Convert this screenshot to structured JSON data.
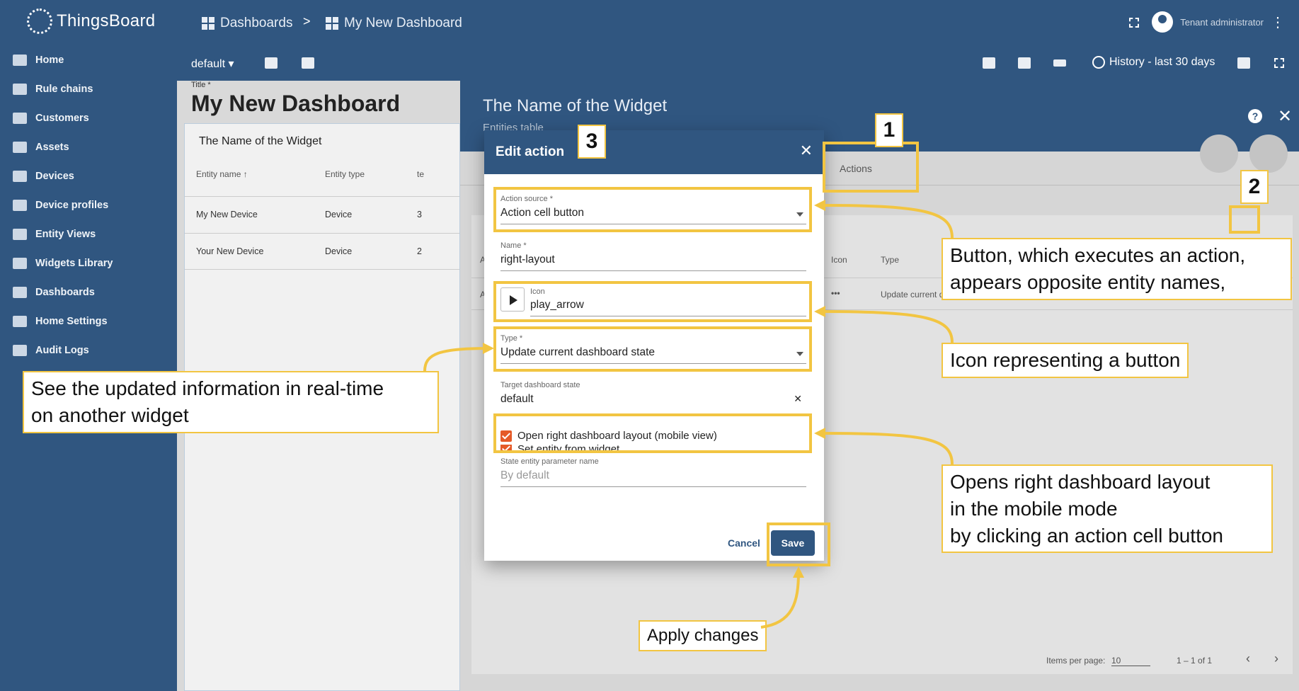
{
  "app": {
    "name": "ThingsBoard"
  },
  "breadcrumb": {
    "root": "Dashboards",
    "separator": ">",
    "current": "My New Dashboard"
  },
  "user": {
    "role": "Tenant administrator"
  },
  "sidebar": {
    "items": [
      {
        "label": "Home",
        "icon": "home-icon"
      },
      {
        "label": "Rule chains",
        "icon": "rule-chains-icon"
      },
      {
        "label": "Customers",
        "icon": "customers-icon"
      },
      {
        "label": "Assets",
        "icon": "assets-icon"
      },
      {
        "label": "Devices",
        "icon": "devices-icon"
      },
      {
        "label": "Device profiles",
        "icon": "device-profiles-icon"
      },
      {
        "label": "Entity Views",
        "icon": "entity-views-icon"
      },
      {
        "label": "Widgets Library",
        "icon": "widgets-icon"
      },
      {
        "label": "Dashboards",
        "icon": "dashboards-icon"
      },
      {
        "label": "Home Settings",
        "icon": "settings-icon"
      },
      {
        "label": "Audit Logs",
        "icon": "audit-logs-icon"
      }
    ]
  },
  "toolbar": {
    "state": "default",
    "history": "History - last 30 days"
  },
  "dashboard": {
    "title_label": "Title *",
    "title": "My New Dashboard",
    "widget": {
      "title": "The Name of the Widget",
      "columns": [
        "Entity name",
        "Entity type",
        "te"
      ],
      "rows": [
        {
          "name": "My New Device",
          "type": "Device",
          "extra": "3"
        },
        {
          "name": "Your New Device",
          "type": "Device",
          "extra": "2"
        }
      ]
    }
  },
  "editor": {
    "title": "The Name of the Widget",
    "subtitle": "Entities table",
    "tab_actions": "Actions",
    "columns": {
      "icon": "Icon",
      "type": "Type",
      "a": "A"
    },
    "row": {
      "icon": "•••",
      "type": "Update current dashboard state",
      "a": "A"
    },
    "pager": {
      "label": "Items per page:",
      "value": "10",
      "range": "1 – 1 of 1"
    }
  },
  "dialog": {
    "title": "Edit action",
    "action_source": {
      "label": "Action source *",
      "value": "Action cell button"
    },
    "name": {
      "label": "Name *",
      "value": "right-layout"
    },
    "icon": {
      "label": "Icon",
      "value": "play_arrow"
    },
    "type": {
      "label": "Type *",
      "value": "Update current dashboard state"
    },
    "target_state": {
      "label": "Target dashboard state",
      "value": "default"
    },
    "open_right_layout": "Open right dashboard layout (mobile view)",
    "set_entity": "Set entity from widget",
    "state_param": {
      "label": "State entity parameter name",
      "placeholder": "By default"
    },
    "cancel": "Cancel",
    "save": "Save"
  },
  "annotations": {
    "num1": "1",
    "num2": "2",
    "num3": "3",
    "button_desc_1": "Button, which executes an action,",
    "button_desc_2": "appears opposite entity names,",
    "icon_desc": "Icon representing a button",
    "realtime_1": "See the updated information in real-time",
    "realtime_2": "on another widget",
    "opens_1": "Opens right dashboard layout",
    "opens_2": "in the mobile mode",
    "opens_3": "by clicking an action cell button",
    "apply": "Apply changes"
  },
  "colors": {
    "primary": "#305680",
    "highlight": "#f2c542",
    "checkbox": "#e55a28"
  }
}
